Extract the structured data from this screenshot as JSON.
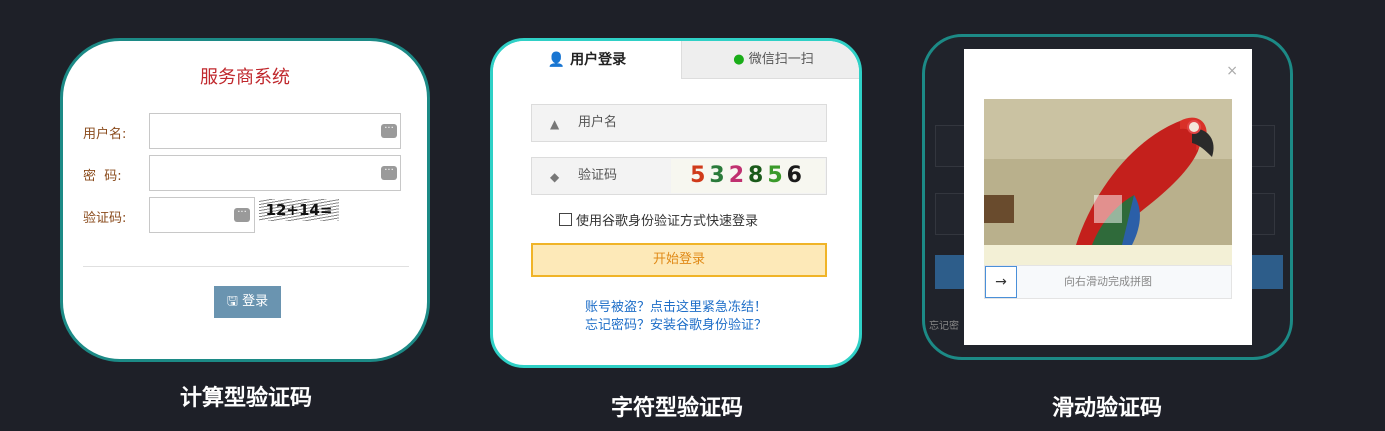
{
  "calc_card": {
    "title": "服务商系统",
    "username_label": "用户名:",
    "password_label": "密  码:",
    "captcha_label": "验证码:",
    "captcha_text": "12+14=",
    "field_icon": "···",
    "login_button": "登录",
    "caption": "计算型验证码"
  },
  "char_card": {
    "tab_login": "用户登录",
    "tab_wechat": "微信扫一扫",
    "username_placeholder": "用户名",
    "captcha_placeholder": "验证码",
    "captcha_chars": "532856",
    "google_checkbox": "使用谷歌身份验证方式快速登录",
    "start_button": "开始登录",
    "link_freeze": "账号被盗？点击这里紧急冻结！",
    "link_forgot": "忘记密码？安装谷歌身份验证？",
    "caption": "字符型验证码"
  },
  "slide_card": {
    "close": "×",
    "slider_hint": "向右滑动完成拼图",
    "handle_arrow": "→",
    "bg_text": "忘记密",
    "caption": "滑动验证码"
  }
}
